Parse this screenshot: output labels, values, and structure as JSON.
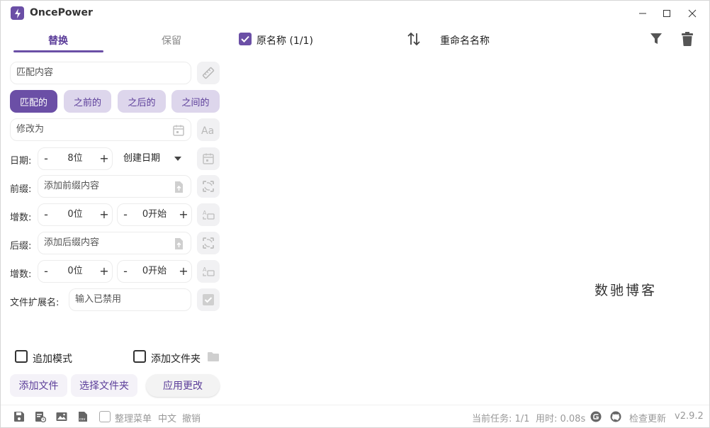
{
  "app": {
    "title": "OncePower"
  },
  "tabs": {
    "replace": "替换",
    "keep": "保留"
  },
  "match": {
    "placeholder": "匹配内容"
  },
  "match_modes": [
    "匹配的",
    "之前的",
    "之后的",
    "之间的"
  ],
  "replace_with": {
    "placeholder": "修改为"
  },
  "date": {
    "label": "日期:",
    "digits": "8位",
    "type": "创建日期"
  },
  "prefix": {
    "label": "前缀:",
    "placeholder": "添加前缀内容"
  },
  "prefix_increment": {
    "label": "增数:",
    "digits": "0位",
    "start": "0开始"
  },
  "suffix": {
    "label": "后缀:",
    "placeholder": "添加后缀内容"
  },
  "suffix_increment": {
    "label": "增数:",
    "digits": "0位",
    "start": "0开始"
  },
  "extension": {
    "label": "文件扩展名:",
    "placeholder": "输入已禁用"
  },
  "options": {
    "append_mode": "追加模式",
    "add_folder": "添加文件夹"
  },
  "actions": {
    "add_file": "添加文件",
    "select_folder": "选择文件夹",
    "apply": "应用更改"
  },
  "list_header": {
    "original": "原名称 (1/1)",
    "renamed": "重命名名称"
  },
  "watermark": "数驰博客",
  "status": {
    "organize_menu": "整理菜单",
    "language": "中文",
    "undo": "撤销",
    "current_task": "当前任务: 1/1",
    "elapsed": "用时: 0.08s",
    "check_update": "检查更新",
    "version": "v2.9.2"
  },
  "colors": {
    "accent": "#6b4fa6",
    "pill": "#ddd6ec"
  }
}
